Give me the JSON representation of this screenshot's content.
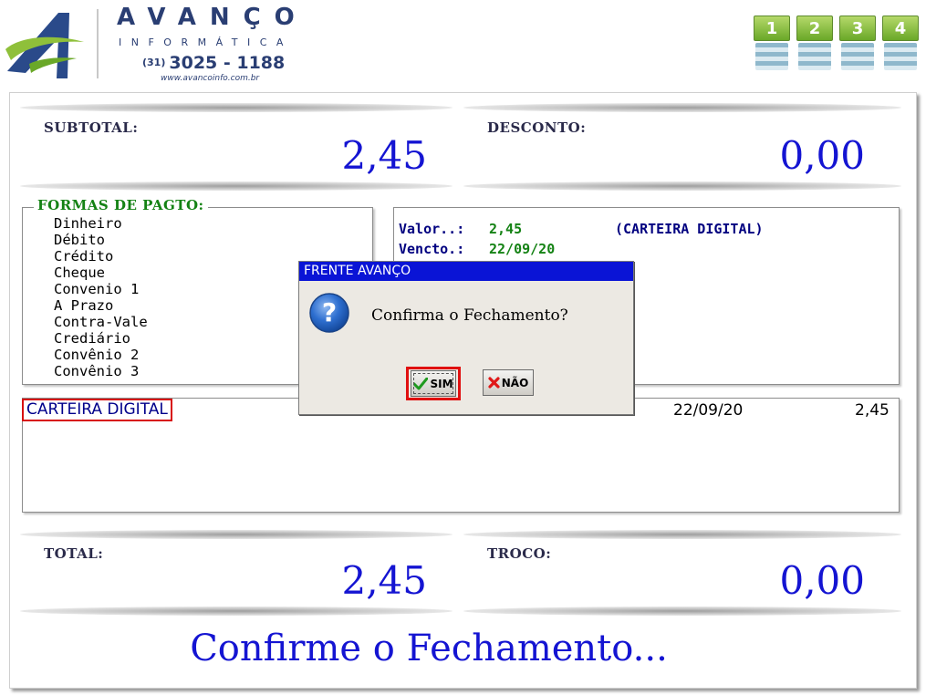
{
  "header": {
    "brand_title": "AVANÇO",
    "brand_sub": "INFORMÁTICA",
    "phone_ddd": "(31)",
    "phone": "3025 - 1188",
    "site": "www.avancoinfo.com.br",
    "monitors": [
      "1",
      "2",
      "3",
      "4"
    ]
  },
  "subtotal": {
    "label": "SUBTOTAL:",
    "value": "2,45"
  },
  "desconto": {
    "label": "DESCONTO:",
    "value": "0,00"
  },
  "payment_methods": {
    "title": "FORMAS DE PAGTO:",
    "items": [
      "Dinheiro",
      "Débito",
      "Crédito",
      "Cheque",
      "Convenio 1",
      "A Prazo",
      "Contra-Vale",
      "Crediário",
      "Convênio 2",
      "Convênio 3"
    ]
  },
  "info": {
    "valor_label": "Valor..:",
    "valor": "2,45",
    "method": "(CARTEIRA DIGITAL)",
    "vencto_label": "Vencto.:",
    "vencto": "22/09/20"
  },
  "selection": {
    "method": "CARTEIRA DIGITAL",
    "date": "22/09/20",
    "amount": "2,45"
  },
  "total": {
    "label": "TOTAL:",
    "value": "2,45"
  },
  "troco": {
    "label": "TROCO:",
    "value": "0,00"
  },
  "status_message": "Confirme o Fechamento...",
  "dialog": {
    "title": "FRENTE AVANÇO",
    "message": "Confirma o Fechamento?",
    "yes_label": "SIM",
    "no_label": "NÃO"
  },
  "colors": {
    "value_blue": "#1414d2",
    "label_green": "#148214",
    "dialog_title_bg": "#0a14d6",
    "highlight_red": "#d81010"
  }
}
